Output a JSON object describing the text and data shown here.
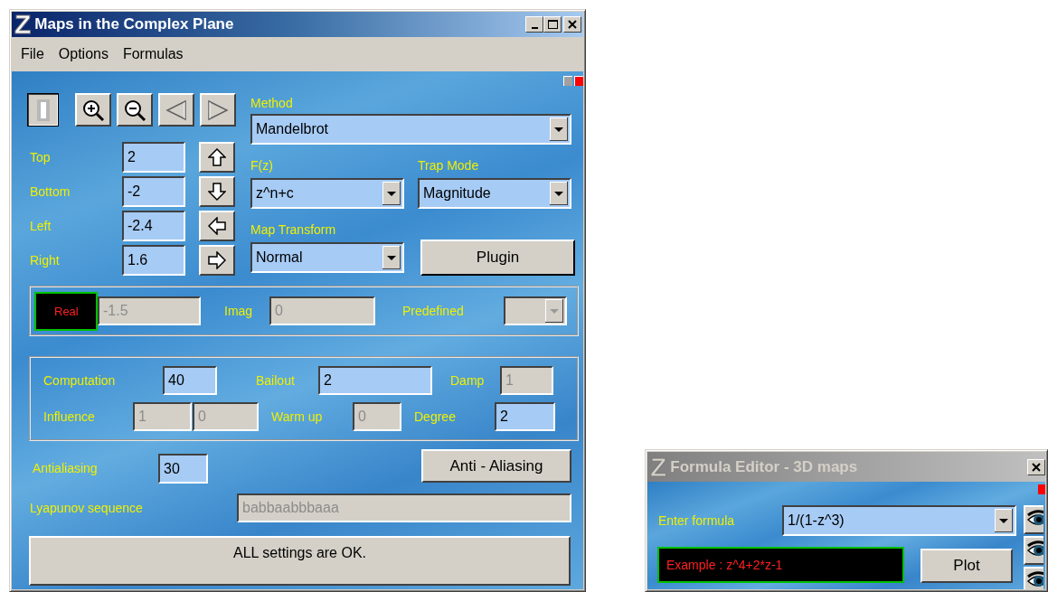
{
  "main_window": {
    "logo": "Z",
    "title": "Maps in the Complex Plane",
    "active": true,
    "menu": [
      "File",
      "Options",
      "Formulas"
    ],
    "tools": [
      {
        "kind": "select",
        "selected": true
      },
      {
        "kind": "zoom-in",
        "selected": false
      },
      {
        "kind": "zoom-out",
        "selected": false
      },
      {
        "kind": "previous",
        "selected": false
      },
      {
        "kind": "next",
        "selected": false
      }
    ],
    "bounds": [
      {
        "label": "Top",
        "value": "2",
        "kind": "up"
      },
      {
        "label": "Bottom",
        "value": "-2",
        "kind": "down"
      },
      {
        "label": "Left",
        "value": "-2.4",
        "kind": "left"
      },
      {
        "label": "Right",
        "value": "1.6",
        "kind": "right"
      }
    ],
    "method": {
      "label": "Method",
      "value": "Mandelbrot"
    },
    "fz": {
      "label": "F(z)",
      "value": "z^n+c"
    },
    "trap_mode": {
      "label": "Trap Mode",
      "value": "Magnitude"
    },
    "map_transform": {
      "label": "Map Transform",
      "value": "Normal"
    },
    "plugin_button": "Plugin",
    "seed": {
      "indicator": "Real",
      "real": {
        "value": "-1.5",
        "disabled": true
      },
      "imag_label": "Imag",
      "imag": {
        "value": "0",
        "disabled": true
      },
      "predefined_label": "Predefined",
      "predefined": {
        "disabled": true
      }
    },
    "parameters": [
      [
        {
          "kind": "label",
          "text": "Computation"
        },
        {
          "kind": "field",
          "value": "40",
          "disabled": false
        },
        {
          "kind": "label",
          "text": "Bailout"
        },
        {
          "kind": "field",
          "value": "2",
          "disabled": false
        },
        {
          "kind": "label",
          "text": "Damp"
        },
        {
          "kind": "field",
          "value": "1",
          "disabled": true
        }
      ],
      [
        {
          "kind": "label",
          "text": "Influence"
        },
        {
          "kind": "field",
          "value": "1",
          "disabled": true
        },
        {
          "kind": "field",
          "value": "0",
          "disabled": true
        },
        {
          "kind": "label",
          "text": "Warm up"
        },
        {
          "kind": "field",
          "value": "0",
          "disabled": true
        },
        {
          "kind": "label",
          "text": "Degree"
        },
        {
          "kind": "field",
          "value": "2",
          "disabled": false
        }
      ]
    ],
    "antialiasing": {
      "label": "Antialiasing",
      "value": "30"
    },
    "antialias_button": "Anti - Aliasing",
    "lyapunov": {
      "label": "Lyapunov sequence",
      "value": "babbaabbbaaa",
      "disabled": true
    },
    "status": "ALL settings are OK."
  },
  "formula_window": {
    "logo": "Z",
    "title": "Formula Editor - 3D maps",
    "active": false,
    "label": "Enter formula",
    "formula": "1/(1-z^3)",
    "example": "Example : z^4+2*z-1",
    "plot_button": "Plot",
    "side_buttons": [
      {
        "kind": "eye"
      },
      {
        "kind": "eye"
      },
      {
        "kind": "eye"
      }
    ]
  }
}
